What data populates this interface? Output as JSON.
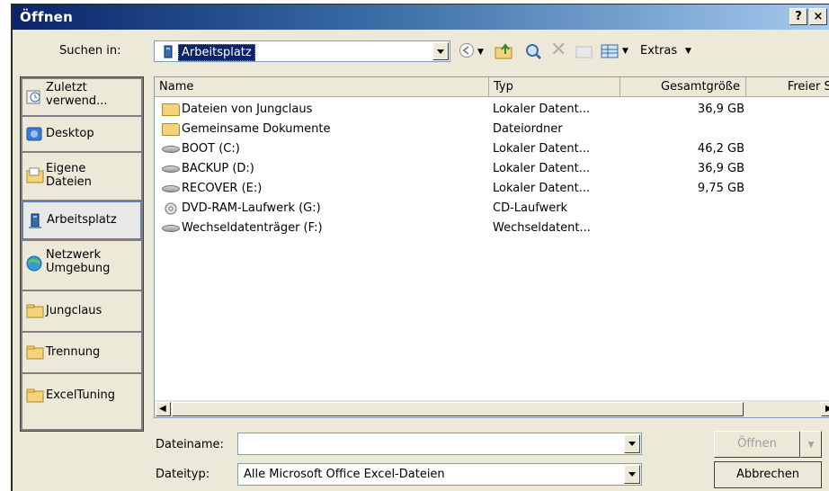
{
  "window": {
    "title": "Öffnen",
    "help_label": "?",
    "close_label": "×"
  },
  "lookin": {
    "label": "Suchen in:",
    "value": "Arbeitsplatz"
  },
  "toolbar": {
    "extras_label": "Extras"
  },
  "places": [
    {
      "label": "Zuletzt verwend...",
      "icon": "recent-icon"
    },
    {
      "label": "Desktop",
      "icon": "desktop-icon"
    },
    {
      "label": "Eigene Dateien",
      "icon": "my-documents-icon"
    },
    {
      "label": "Arbeitsplatz",
      "icon": "my-computer-icon"
    },
    {
      "label": "Netzwerk Umgebung",
      "icon": "network-icon"
    },
    {
      "label": "Jungclaus",
      "icon": "folder-icon"
    },
    {
      "label": "Trennung",
      "icon": "folder-icon"
    },
    {
      "label": "ExcelTuning",
      "icon": "folder-icon"
    }
  ],
  "columns": [
    "Name",
    "Typ",
    "Gesamtgröße",
    "Freier Sp"
  ],
  "files": [
    {
      "name": "Dateien von Jungclaus",
      "type": "Lokaler Datent...",
      "size": "36,9 GB",
      "icon": "folder-icon"
    },
    {
      "name": "Gemeinsame Dokumente",
      "type": "Dateiordner",
      "size": "",
      "icon": "folder-icon"
    },
    {
      "name": "BOOT (C:)",
      "type": "Lokaler Datent...",
      "size": "46,2 GB",
      "icon": "drive-icon"
    },
    {
      "name": "BACKUP (D:)",
      "type": "Lokaler Datent...",
      "size": "36,9 GB",
      "icon": "drive-icon"
    },
    {
      "name": "RECOVER (E:)",
      "type": "Lokaler Datent...",
      "size": "9,75 GB",
      "icon": "drive-icon"
    },
    {
      "name": "DVD-RAM-Laufwerk (G:)",
      "type": "CD-Laufwerk",
      "size": "",
      "icon": "dvd-drive-icon"
    },
    {
      "name": "Wechseldatenträger (F:)",
      "type": "Wechseldatent...",
      "size": "",
      "icon": "removable-drive-icon"
    }
  ],
  "filename": {
    "label": "Dateiname:",
    "value": ""
  },
  "filetype": {
    "label": "Dateityp:",
    "value": "Alle Microsoft Office Excel-Dateien"
  },
  "buttons": {
    "open": "Öffnen",
    "cancel": "Abbrechen"
  }
}
